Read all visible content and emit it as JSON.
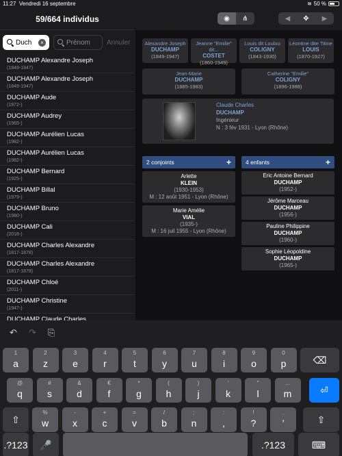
{
  "status": {
    "time": "11:27",
    "date": "Vendredi 16 septembre",
    "battery": "50 %"
  },
  "left": {
    "title": "59/664 individus",
    "search_value": "Duch",
    "firstname_placeholder": "Prénom",
    "cancel_label": "Annuler",
    "rows": [
      {
        "name": "DUCHAMP Alexandre Joseph",
        "dates": "(1849-1947)"
      },
      {
        "name": "DUCHAMP Alexandre Joseph",
        "dates": "(1849-1947)"
      },
      {
        "name": "DUCHAMP Aude",
        "dates": "(1972-)"
      },
      {
        "name": "DUCHAMP Audrey",
        "dates": "(1965-)"
      },
      {
        "name": "DUCHAMP Aurélien Lucas",
        "dates": "(1982-)"
      },
      {
        "name": "DUCHAMP Aurélien Lucas",
        "dates": "(1982-)"
      },
      {
        "name": "DUCHAMP Bernard",
        "dates": "(1925-)"
      },
      {
        "name": "DUCHAMP Billal",
        "dates": "(1979-)"
      },
      {
        "name": "DUCHAMP Bruno",
        "dates": "(1980-)"
      },
      {
        "name": "DUCHAMP Cali",
        "dates": "(2018-)"
      },
      {
        "name": "DUCHAMP Charles Alexandre",
        "dates": "(1817-1878)"
      },
      {
        "name": "DUCHAMP Charles Alexandre",
        "dates": "(1817-1878)"
      },
      {
        "name": "DUCHAMP Chloé",
        "dates": "(2011-)"
      },
      {
        "name": "DUCHAMP Christine",
        "dates": "(1947-)"
      },
      {
        "name": "DUCHAMP Claude Charles",
        "dates": ""
      }
    ]
  },
  "right": {
    "view_segments": [
      "eye-icon",
      "tree-icon"
    ],
    "nav_segments": [
      "left-arrow-icon",
      "move-icon",
      "right-arrow-icon"
    ],
    "grandparents": [
      {
        "first": "Alexandre Joseph",
        "last": "DUCHAMP",
        "dates": "(1849-1947)"
      },
      {
        "first": "Jeanne \"Emilie\" dit...",
        "last": "COSTET",
        "dates": "(1860-1949)"
      },
      {
        "first": "Louis dit Loulou",
        "last": "COLIGNY",
        "dates": "(1843-1930)"
      },
      {
        "first": "Léontine dite Titine",
        "last": "LOUIS",
        "dates": "(1870-1927)"
      }
    ],
    "parents": [
      {
        "first": "Jean-Marie",
        "last": "DUCHAMP",
        "dates": "(1885-1983)"
      },
      {
        "first": "Catherine \"Emilie\"",
        "last": "COLIGNY",
        "dates": "(1896-1988)"
      }
    ],
    "focus": {
      "first": "Claude Charles",
      "last": "DUCHAMP",
      "occupation": "Ingénieur",
      "birth": "N : 3 fév 1931 - Lyon (Rhône)"
    },
    "spouses_header": "2 conjoints",
    "children_header": "4 enfants",
    "spouses": [
      {
        "first": "Arlette",
        "last": "KLEIN",
        "dates": "(1930-1953)",
        "marriage": "M : 12 août 1951 - Lyon (Rhône)"
      },
      {
        "first": "Marie Amélie",
        "last": "VIAL",
        "dates": "(1935-)",
        "marriage": "M : 16 juil 1955 - Lyon (Rhône)"
      }
    ],
    "children": [
      {
        "first": "Eric Antoine Bernard",
        "last": "DUCHAMP",
        "dates": "(1952-)"
      },
      {
        "first": "Jérôme Marceau",
        "last": "DUCHAMP",
        "dates": "(1956-)"
      },
      {
        "first": "Pauline Philippine",
        "last": "DUCHAMP",
        "dates": "(1960-)"
      },
      {
        "first": "Sophie Léopoldine",
        "last": "DUCHAMP",
        "dates": "(1965-)"
      }
    ]
  },
  "keyboard": {
    "row1": [
      {
        "k": "a",
        "s": "1"
      },
      {
        "k": "z",
        "s": "2"
      },
      {
        "k": "e",
        "s": "3"
      },
      {
        "k": "r",
        "s": "4"
      },
      {
        "k": "t",
        "s": "5"
      },
      {
        "k": "y",
        "s": "6"
      },
      {
        "k": "u",
        "s": "7"
      },
      {
        "k": "i",
        "s": "8"
      },
      {
        "k": "o",
        "s": "9"
      },
      {
        "k": "p",
        "s": "0"
      }
    ],
    "row2": [
      {
        "k": "q",
        "s": "@"
      },
      {
        "k": "s",
        "s": "#"
      },
      {
        "k": "d",
        "s": "&"
      },
      {
        "k": "f",
        "s": "€"
      },
      {
        "k": "g",
        "s": "*"
      },
      {
        "k": "h",
        "s": "("
      },
      {
        "k": "j",
        "s": ")"
      },
      {
        "k": "k",
        "s": "'"
      },
      {
        "k": "l",
        "s": "\""
      },
      {
        "k": "m",
        "s": "…"
      }
    ],
    "row3": [
      {
        "k": "w",
        "s": "%"
      },
      {
        "k": "x",
        "s": "-"
      },
      {
        "k": "c",
        "s": "+"
      },
      {
        "k": "v",
        "s": "="
      },
      {
        "k": "b",
        "s": "/"
      },
      {
        "k": "n",
        "s": ";"
      },
      {
        "k": ",",
        "s": ":"
      },
      {
        "k": "?",
        "s": "!"
      },
      {
        "k": "’",
        "s": "."
      }
    ],
    "numbers_label": ".?123"
  }
}
